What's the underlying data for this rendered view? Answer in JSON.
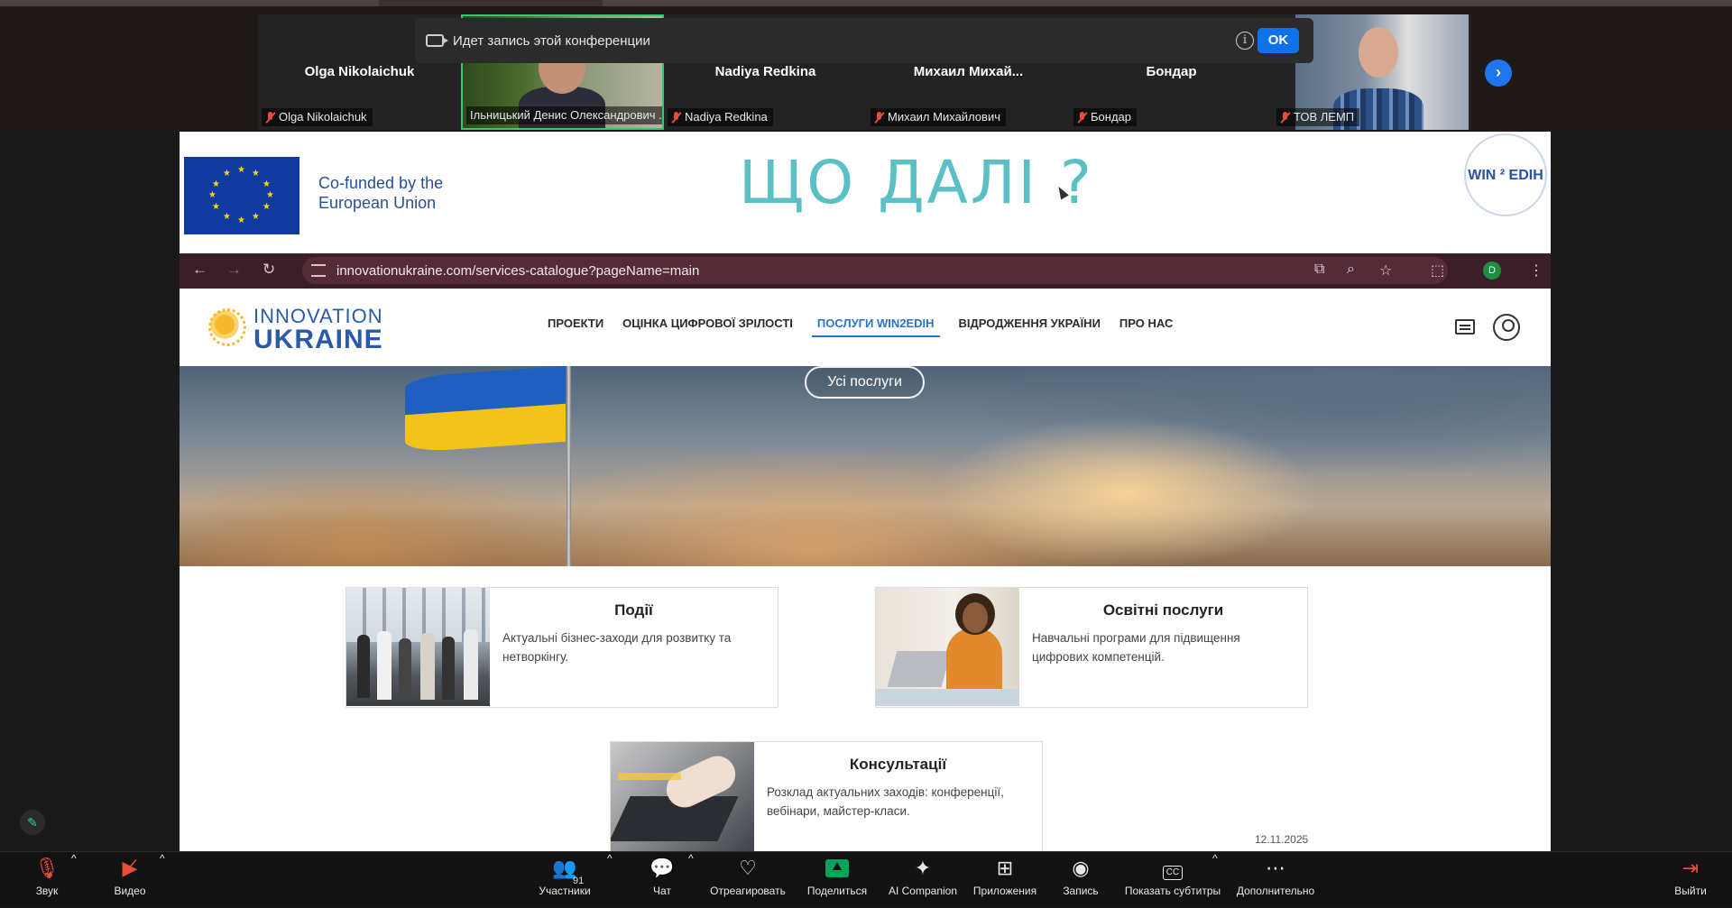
{
  "meeting": {
    "recording_banner": "Идет запись этой конференции",
    "ok_label": "OK"
  },
  "participants": [
    {
      "name": "Olga Nikolaichuk",
      "label": "Olga Nikolaichuk"
    },
    {
      "name": "",
      "label": "Ільницький Денис Олександрович ..."
    },
    {
      "name": "Nadiya Redkina",
      "label": "Nadiya Redkina"
    },
    {
      "name": "Михаил  Михай...",
      "label": "Михаил Михайлович"
    },
    {
      "name": "Бондар",
      "label": "Бондар"
    },
    {
      "name": "",
      "label": "ТОВ ЛЕМП"
    }
  ],
  "slide": {
    "eu_line1": "Co-funded by the",
    "eu_line2": "European Union",
    "title": "ЩО ДАЛІ ?",
    "logo_text": "WIN ² EDIH"
  },
  "browser": {
    "url": "innovationukraine.com/services-catalogue?pageName=main"
  },
  "site": {
    "logo_line1": "INNOVATION",
    "logo_line2": "UKRAINE",
    "nav": [
      "ПРОЕКТИ",
      "ОЦІНКА ЦИФРОВОЇ ЗРІЛОСТІ",
      "ПОСЛУГИ WIN2EDIH",
      "ВІДРОДЖЕННЯ УКРАЇНИ",
      "ПРО НАС"
    ],
    "all_services": "Усі послуги",
    "cards": [
      {
        "title": "Події",
        "desc": "Актуальні бізнес-заходи для розвитку та нетворкінгу."
      },
      {
        "title": "Освітні послуги",
        "desc": "Навчальні програми для підвищення цифрових компетенцій."
      },
      {
        "title": "Консультації",
        "desc": "Розклад актуальних заходів: конференції, вебінари, майстер-класи."
      }
    ],
    "date": "12.11.2025"
  },
  "toolbar": {
    "audio": "Звук",
    "video": "Видео",
    "participants": "Участники",
    "participants_count": "91",
    "chat": "Чат",
    "react": "Отреагировать",
    "share": "Поделиться",
    "ai": "AI Companion",
    "apps": "Приложения",
    "record": "Запись",
    "captions": "Показать субтитры",
    "more": "Дополнительно",
    "leave": "Выйти"
  },
  "colors": {
    "accent": "#0e72ed",
    "share_green": "#00a35c",
    "slide_title": "#5bc0c5",
    "browser_bar": "#3b1e28",
    "active_nav": "#2a74c5"
  }
}
